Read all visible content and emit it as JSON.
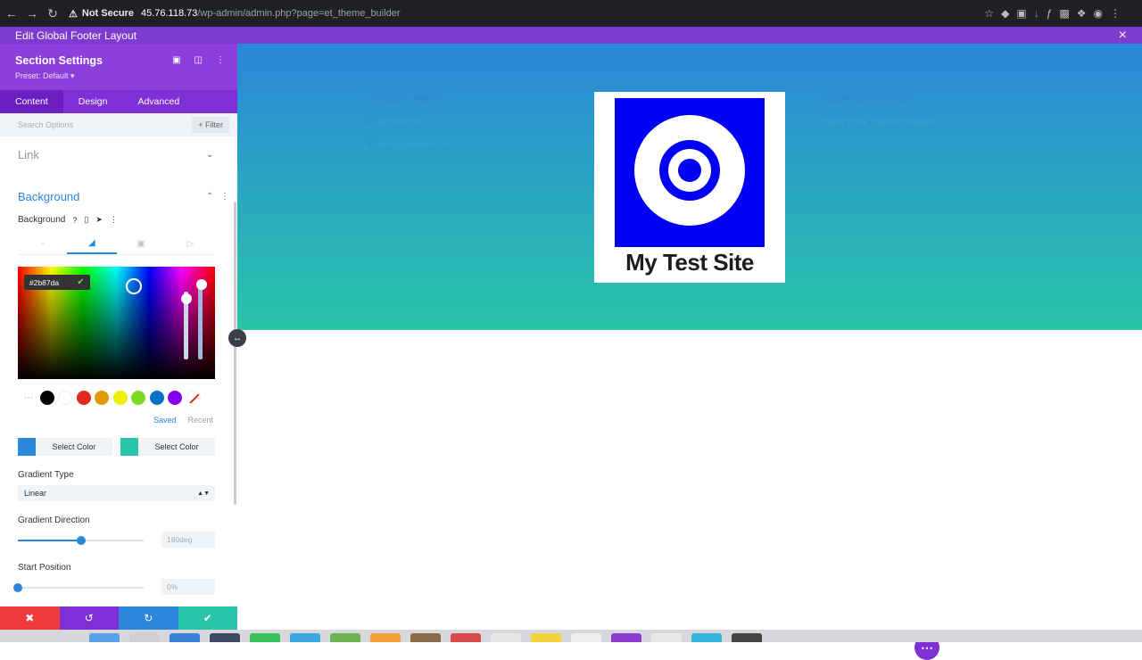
{
  "browser": {
    "not_secure": "Not Secure",
    "url_host": "45.76.118.73",
    "url_path": "/wp-admin/admin.php?page=et_theme_builder"
  },
  "topbar": {
    "title": "Edit Global Footer Layout",
    "close_icon": "×"
  },
  "panel": {
    "title": "Section Settings",
    "preset": "Preset: Default ▾",
    "tabs": [
      {
        "label": "Content",
        "active": true
      },
      {
        "label": "Design",
        "active": false
      },
      {
        "label": "Advanced",
        "active": false
      }
    ],
    "search_placeholder": "Search Options",
    "filter_label": "+ Filter",
    "link_toggle": "Link",
    "background_toggle": "Background",
    "background_label": "Background",
    "hex_value": "#2b87da",
    "swatches": [
      "#000000",
      "#ffffff",
      "#e02b20",
      "#e09900",
      "#edf000",
      "#7cda24",
      "#0c71c3",
      "#8300e9"
    ],
    "saved_label": "Saved",
    "recent_label": "Recent",
    "gradient_start_color": "#2b87da",
    "gradient_end_color": "#29c4a9",
    "select_color_label": "Select Color",
    "gradient_type_label": "Gradient Type",
    "gradient_type_value": "Linear",
    "gradient_direction_label": "Gradient Direction",
    "gradient_direction_value": "180deg",
    "gradient_direction_fraction": 0.5,
    "start_position_label": "Start Position",
    "start_position_value": "0%",
    "start_position_fraction": 0.0
  },
  "canvas": {
    "address": "123 Main St. New York",
    "phone_label": "P:",
    "phone_value": "555.555.5555",
    "email_label": "E:",
    "email_value": "info@mytestsite.com",
    "copyright": "Copywrite 2020 MyTestSite",
    "footer_link_1": "Privacy Policy",
    "footer_separator": "|",
    "footer_link_2": "Terms & Conditions",
    "logo_title": "My Test Site",
    "logo_color": "#0000f5"
  },
  "colors": {
    "accent": "#2b87da",
    "divi_purple": "#7e2fd6"
  }
}
